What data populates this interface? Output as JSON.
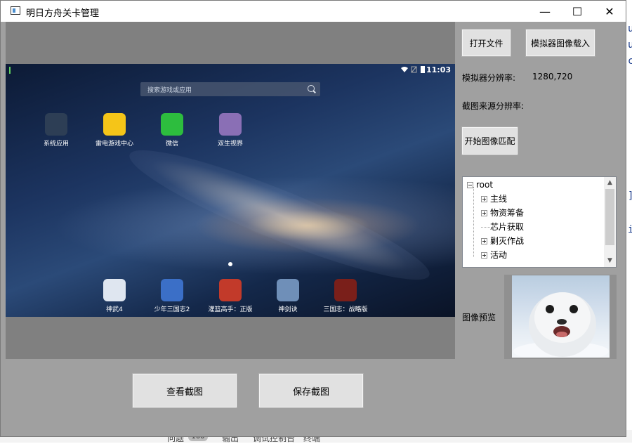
{
  "window": {
    "title": "明日方舟关卡管理",
    "minimize_glyph": "—",
    "maximize_glyph": "☐",
    "close_glyph": "✕"
  },
  "emulator": {
    "status_time": "11:03",
    "search_placeholder": "搜索游戏或应用",
    "top_apps": [
      {
        "label": "系统应用",
        "icon": "folder-icon",
        "color": "#2d3e55"
      },
      {
        "label": "雷电游戏中心",
        "icon": "gamepad-icon",
        "color": "#f5c518"
      },
      {
        "label": "微信",
        "icon": "wechat-icon",
        "color": "#2dbd3e"
      },
      {
        "label": "双生视界",
        "icon": "game-avatar-icon",
        "color": "#8a6fb5"
      }
    ],
    "bottom_apps": [
      {
        "label": "神武4",
        "icon": "panda-icon",
        "color": "#dfe6f0"
      },
      {
        "label": "少年三国志2",
        "icon": "hero-icon",
        "color": "#3b6fc7"
      },
      {
        "label": "灌篮高手：正版",
        "icon": "basketball-icon",
        "color": "#c23a2a"
      },
      {
        "label": "神剑诀",
        "icon": "sword-icon",
        "color": "#6f8fb8"
      },
      {
        "label": "三国志：战略版",
        "icon": "sanguo-icon",
        "color": "#7a1f1a"
      }
    ]
  },
  "panel": {
    "open_file_button": "打开文件",
    "load_emulator_button": "模拟器图像载入",
    "emulator_resolution_label": "模拟器分辨率:",
    "emulator_resolution_value": "1280,720",
    "source_resolution_label": "截图来源分辨率:",
    "start_match_button": "开始图像匹配",
    "preview_label": "图像预览"
  },
  "tree": {
    "root": "root",
    "items": [
      {
        "label": "主线",
        "expandable": true
      },
      {
        "label": "物资筹备",
        "expandable": true
      },
      {
        "label": "芯片获取",
        "expandable": false
      },
      {
        "label": "剿灭作战",
        "expandable": true
      },
      {
        "label": "活动",
        "expandable": true
      }
    ]
  },
  "bottom": {
    "view_screenshot_button": "查看截图",
    "save_screenshot_button": "保存截图"
  },
  "background": {
    "right_chars": [
      "u",
      "u",
      "c",
      "]",
      "i"
    ],
    "taskbar_tabs": [
      "问题",
      "输出",
      "调试控制台",
      "终端"
    ],
    "problems_count": "100"
  }
}
